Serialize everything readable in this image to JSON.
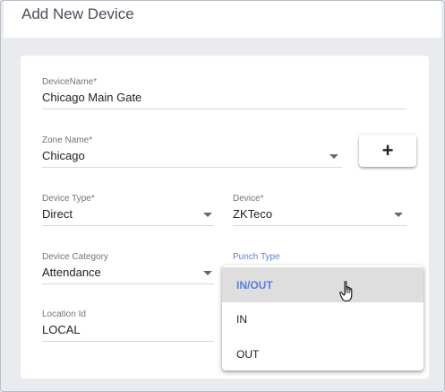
{
  "header": {
    "title": "Add New Device"
  },
  "form": {
    "device_name": {
      "label": "DeviceName*",
      "value": "Chicago Main Gate"
    },
    "zone_name": {
      "label": "Zone Name*",
      "value": "Chicago"
    },
    "add_button": {
      "label": "+"
    },
    "device_type": {
      "label": "Device Type*",
      "value": "Direct"
    },
    "device": {
      "label": "Device*",
      "value": "ZKTeco"
    },
    "device_category": {
      "label": "Device Category",
      "value": "Attendance"
    },
    "punch_type": {
      "label": "Punch Type"
    },
    "location_id": {
      "label": "Location Id",
      "value": "LOCAL"
    }
  },
  "punch_dropdown": {
    "options": [
      "IN/OUT",
      "IN",
      "OUT"
    ],
    "selected": "IN/OUT"
  },
  "colors": {
    "accent": "#5b7fe0",
    "selected_bg": "#dedede"
  },
  "icons": {
    "dropdown": "caret-down-icon",
    "cursor": "hand-pointer-icon"
  }
}
